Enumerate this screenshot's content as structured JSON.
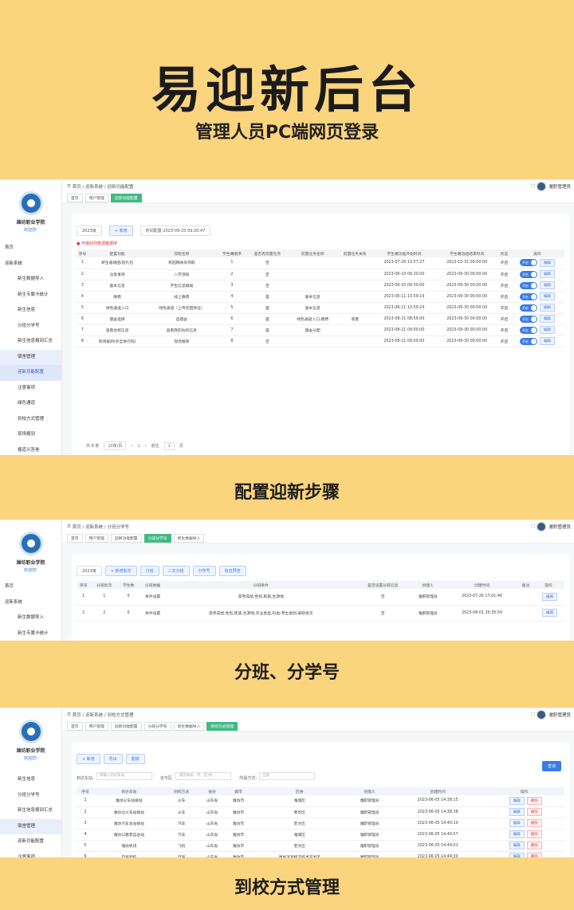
{
  "hero": {
    "title": "易迎新后台",
    "subtitle": "管理人员PC端网页登录"
  },
  "captions": [
    "配置迎新步骤",
    "分班、分学号",
    "到校方式管理"
  ],
  "school": {
    "name": "潍坊职业学院",
    "welcome": "欢迎您!"
  },
  "user": "潍职管理员",
  "s1": {
    "breadcrumb": [
      "首页",
      "迎新系统",
      "迎新功能配置"
    ],
    "tags": [
      "首页",
      "用户管理",
      "迎新功能配置"
    ],
    "menu": [
      "首页",
      "迎新系统",
      "新生数据导入",
      "新生专属卡统计",
      "新生信息",
      "分班分学号",
      "新生信息报到汇总",
      "宿舍管理",
      "迎新功能配置",
      "注意事项",
      "绿色通道",
      "到校方式管理",
      "现场报到",
      "报道义答卷"
    ],
    "year": "2023级",
    "add": "+ 新增",
    "time": "时间配置 2023-09-25 09:20:47",
    "note": "● 可拖动列表调整顺序",
    "headers": [
      "序号",
      "配置功能",
      "流程名称",
      "学生端顺序",
      "是否有前置任务",
      "前置任务名称",
      "前置任务关系",
      "学生端功能开始时间",
      "学生端功能结束时间",
      "状态",
      "操作"
    ],
    "rows": [
      [
        "1",
        "新生邀请函/迎礼包",
        "校园网帐号领取",
        "1",
        "否",
        "",
        "",
        "2023-07-26 13:57:27",
        "2023-10-31 00:00:00",
        "开启"
      ],
      [
        "2",
        "注意事项",
        "入学须知",
        "2",
        "否",
        "",
        "",
        "2023-06-10 09:30:00",
        "2023-09-30 00:00:00",
        "开启"
      ],
      [
        "3",
        "基本信息",
        "学生信息填报",
        "3",
        "否",
        "",
        "",
        "2023-06-10 09:30:00",
        "2023-09-30 00:00:00",
        "开启"
      ],
      [
        "4",
        "缴费",
        "线上缴费",
        "4",
        "是",
        "基本信息",
        "",
        "2023-06-11 13:59:19",
        "2023-09-30 00:00:00",
        "开启"
      ],
      [
        "5",
        "绿色通道入口",
        "绿色通道（上传贫困凭证）",
        "5",
        "是",
        "基本信息",
        "",
        "2023-06-11 13:59:24",
        "2023-09-30 00:00:00",
        "开启"
      ],
      [
        "6",
        "宿舍选择",
        "选宿舍",
        "6",
        "是",
        "绿色通道入口,缴费",
        "或者",
        "2023-08-21 08:59:00",
        "2023-09-30 00:00:00",
        "开启"
      ],
      [
        "7",
        "查看住校信息",
        "查看我的住校信息",
        "7",
        "是",
        "宿舍分配",
        "",
        "2023-08-21 09:00:00",
        "2023-09-30 00:00:00",
        "开启"
      ],
      [
        "8",
        "现场报到(岁全依行码)",
        "现场报到",
        "8",
        "否",
        "",
        "",
        "2023-08-21 09:00:00",
        "2023-09-30 00:00:00",
        "开启"
      ]
    ],
    "switch": "开启",
    "edit": "编辑",
    "pager": {
      "total": "共 8 条",
      "size": "10条/页",
      "page": "1",
      "goto": "前往",
      "page2": "1",
      "unit": "页"
    }
  },
  "s2": {
    "breadcrumb": [
      "首页",
      "迎新系统",
      "分班分学号"
    ],
    "tags": [
      "首页",
      "用户管理",
      "迎新功能配置",
      "分班分学号",
      "新生数据导入"
    ],
    "menu": [
      "首页",
      "迎新系统",
      "新生数据导入",
      "新生专属卡统计"
    ],
    "year": "2023级",
    "buttons": [
      "+ 新增批次",
      "分班",
      "二次分班",
      "分学号",
      "信息预览"
    ],
    "headers": [
      "序号",
      "分班批次",
      "学生数",
      "分班依据",
      "分班条件",
      "是否设置分班信息",
      "创建人",
      "创建时间",
      "备注",
      "操作"
    ],
    "rows": [
      [
        "1",
        "1",
        "0",
        "条件设置",
        "高考成绩,性别,民族,生源地",
        "否",
        "潍职管理员",
        "2023-07-26 17:01:46",
        ""
      ],
      [
        "2",
        "2",
        "0",
        "条件设置",
        "高考成绩,性别,民族,生源地,毕业类型,科类,考生类别,录取批次",
        "否",
        "潍职管理员",
        "2023-08-01 20:35:59",
        ""
      ]
    ],
    "edit": "编辑"
  },
  "s3": {
    "breadcrumb": [
      "首页",
      "迎新系统",
      "到校方式管理"
    ],
    "tags": [
      "首页",
      "用户管理",
      "迎新功能配置",
      "分班分学号",
      "新生数据导入",
      "到校方式管理"
    ],
    "menu": [
      "新生信息",
      "分班分学号",
      "新生信息报到汇总",
      "宿舍管理",
      "迎新功能配置",
      "注意事项"
    ],
    "buttons": [
      "+ 新增",
      "导出",
      "删除"
    ],
    "search_btn": "查询",
    "filters": [
      {
        "label": "到达车站:",
        "placeholder": "请输入到达车站"
      },
      {
        "label": "省市区:",
        "placeholder": "请选择省、市、区/县"
      },
      {
        "label": "所属方式:",
        "placeholder": "全部"
      }
    ],
    "headers": [
      "序号",
      "到达车站",
      "到校方式",
      "省份",
      "城市",
      "区县",
      "创建人",
      "创建时间",
      "操作"
    ],
    "rows": [
      [
        "1",
        "潍坊火车站接站",
        "火车",
        "山东省",
        "潍坊市",
        "潍城区",
        "潍职管理员",
        "2023-06-05 14:38:15"
      ],
      [
        "2",
        "潍坊北火车站接站",
        "火车",
        "山东省",
        "潍坊市",
        "寒亭区",
        "潍职管理员",
        "2023-06-05 14:38:38"
      ],
      [
        "3",
        "潍坊汽车总站接站",
        "汽车",
        "山东省",
        "潍坊市",
        "奎文区",
        "潍职管理员",
        "2023-06-05 14:40:10"
      ],
      [
        "4",
        "潍坊公路客运总站",
        "汽车",
        "山东省",
        "潍坊市",
        "潍城区",
        "潍职管理员",
        "2023-06-05 14:40:57"
      ],
      [
        "5",
        "潍坊机场",
        "飞机",
        "山东省",
        "潍坊市",
        "奎文区",
        "潍职管理员",
        "2023-06-05 14:44:01"
      ],
      [
        "6",
        "自驾到校",
        "自驾",
        "山东省",
        "潍坊市",
        "潍坊滨海经济技术开发区",
        "潍职管理员",
        "2023-06-05 14:44:30"
      ]
    ],
    "edit": "编辑",
    "del": "删除"
  }
}
